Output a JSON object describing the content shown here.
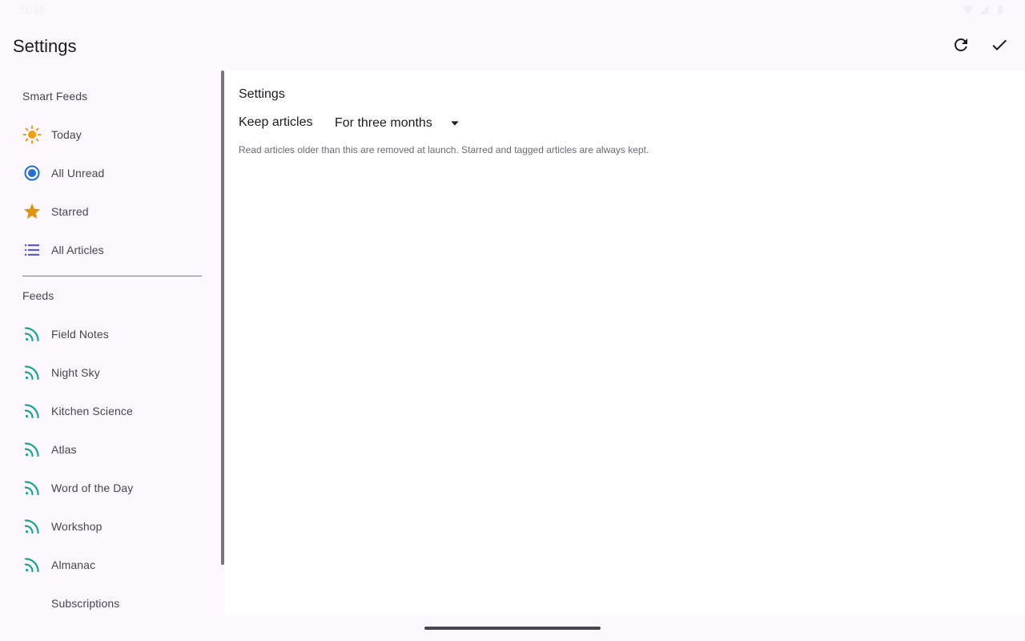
{
  "status_bar": {
    "time": "11:18"
  },
  "app_bar": {
    "title": "Settings",
    "actions": [
      {
        "name": "refresh",
        "icon": "refresh-icon"
      },
      {
        "name": "done",
        "icon": "check-icon"
      }
    ]
  },
  "sidebar": {
    "smart_feeds_header": "Smart Feeds",
    "smart_feeds": [
      {
        "label": "Today",
        "icon": "sun-icon",
        "color": "#f59e0b"
      },
      {
        "label": "All Unread",
        "icon": "radio-dot-icon",
        "color": "#1e6fd9"
      },
      {
        "label": "Starred",
        "icon": "star-icon",
        "color": "#e4940a"
      },
      {
        "label": "All Articles",
        "icon": "list-icon",
        "color": "#5b5bd6"
      }
    ],
    "feeds_header": "Feeds",
    "feeds": [
      {
        "label": "Field Notes",
        "icon": "rss-icon"
      },
      {
        "label": "Night Sky",
        "icon": "rss-icon"
      },
      {
        "label": "Kitchen Science",
        "icon": "rss-icon"
      },
      {
        "label": "Atlas",
        "icon": "rss-icon"
      },
      {
        "label": "Word of the Day",
        "icon": "rss-icon"
      },
      {
        "label": "Workshop",
        "icon": "rss-icon"
      },
      {
        "label": "Almanac",
        "icon": "rss-icon"
      }
    ],
    "subscriptions_label": "Subscriptions",
    "feed_icon_color": "#1aa39a"
  },
  "content": {
    "title": "Settings",
    "keep_articles_label": "Keep articles",
    "keep_articles_value": "For three months",
    "help_text": "Read articles older than this are removed at launch. Starred and tagged articles are always kept."
  }
}
